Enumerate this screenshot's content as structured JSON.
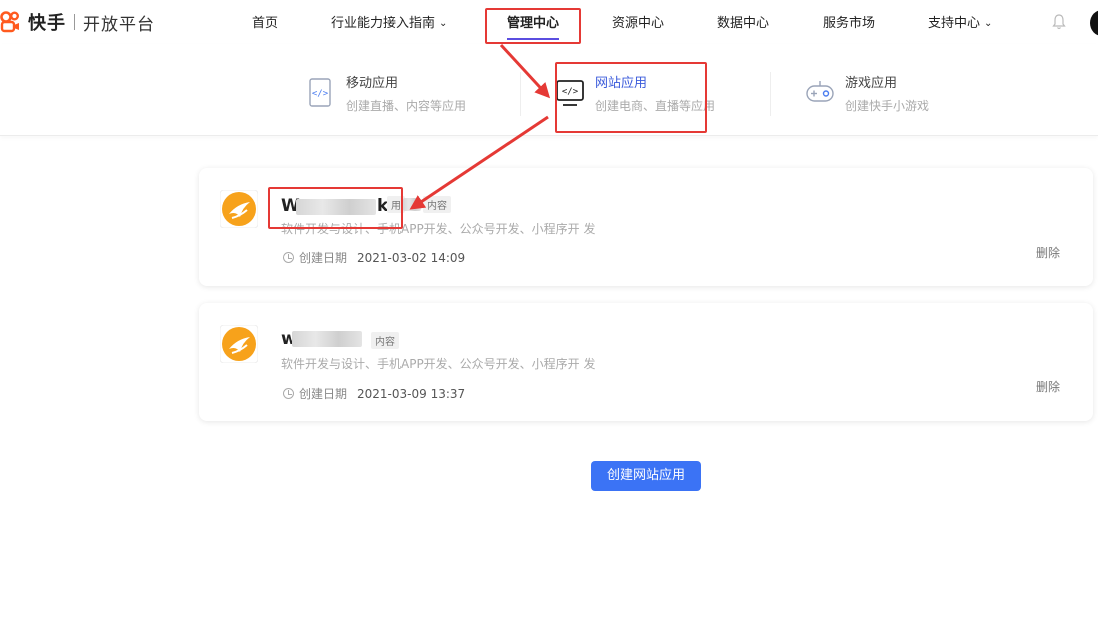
{
  "header": {
    "brand": "快手",
    "platform": "开放平台",
    "nav": [
      {
        "label": "首页",
        "has_dropdown": false
      },
      {
        "label": "行业能力接入指南",
        "has_dropdown": true
      },
      {
        "label": "管理中心",
        "has_dropdown": false,
        "active": true
      },
      {
        "label": "资源中心",
        "has_dropdown": false
      },
      {
        "label": "数据中心",
        "has_dropdown": false
      },
      {
        "label": "服务市场",
        "has_dropdown": false
      },
      {
        "label": "支持中心",
        "has_dropdown": true
      }
    ],
    "icons": {
      "bell": "bell-icon",
      "avatar": "user-avatar"
    },
    "accent": "#5b4ee0"
  },
  "subnav": {
    "items": [
      {
        "title": "移动应用",
        "desc": "创建直播、内容等应用",
        "icon": "mobile-code-icon"
      },
      {
        "title": "网站应用",
        "desc": "创建电商、直播等应用",
        "icon": "website-code-icon",
        "active": true
      },
      {
        "title": "游戏应用",
        "desc": "创建快手小游戏",
        "icon": "gamepad-icon"
      }
    ],
    "active_color": "#3b5bdb"
  },
  "apps": [
    {
      "name_prefix": "W",
      "name_suffix": "ke",
      "tags": [
        "用",
        "内容"
      ],
      "desc": "软件开发与设计、手机APP开发、公众号开发、小程序开 发",
      "created_label": "创建日期",
      "created_at": "2021-03-02 14:09",
      "delete_label": "删除"
    },
    {
      "name_prefix": "w",
      "name_suffix": "",
      "tags": [
        "内容"
      ],
      "desc": "软件开发与设计、手机APP开发、公众号开发、小程序开 发",
      "created_label": "创建日期",
      "created_at": "2021-03-09 13:37",
      "delete_label": "删除"
    }
  ],
  "create_button": {
    "label": "创建网站应用",
    "color": "#3b73f5"
  },
  "annotation_color": "#e53935"
}
